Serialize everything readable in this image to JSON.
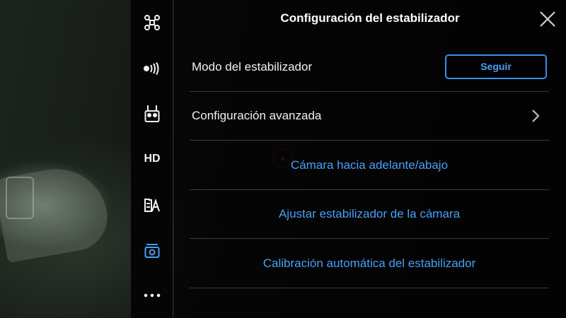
{
  "panel": {
    "title": "Configuración del estabilizador"
  },
  "sidebar": {
    "items": [
      {
        "icon": "drone-icon"
      },
      {
        "icon": "signal-icon"
      },
      {
        "icon": "remote-controller-icon"
      },
      {
        "icon": "hd-icon",
        "label": "HD"
      },
      {
        "icon": "battery-icon"
      },
      {
        "icon": "camera-icon",
        "active": true
      },
      {
        "icon": "more-icon"
      }
    ]
  },
  "rows": {
    "gimbal_mode": {
      "label": "Modo del estabilizador",
      "button": "Seguir"
    },
    "advanced": {
      "label": "Configuración avanzada"
    },
    "camera_forward": {
      "label": "Cámara hacia adelante/abajo"
    },
    "adjust_gimbal": {
      "label": "Ajustar estabilizador de la cámara"
    },
    "auto_calibration": {
      "label": "Calibración automática del estabilizador"
    }
  },
  "colors": {
    "accent": "#4a9ff5",
    "active_icon": "#4a9ff5",
    "divider": "#3a3a3a"
  }
}
